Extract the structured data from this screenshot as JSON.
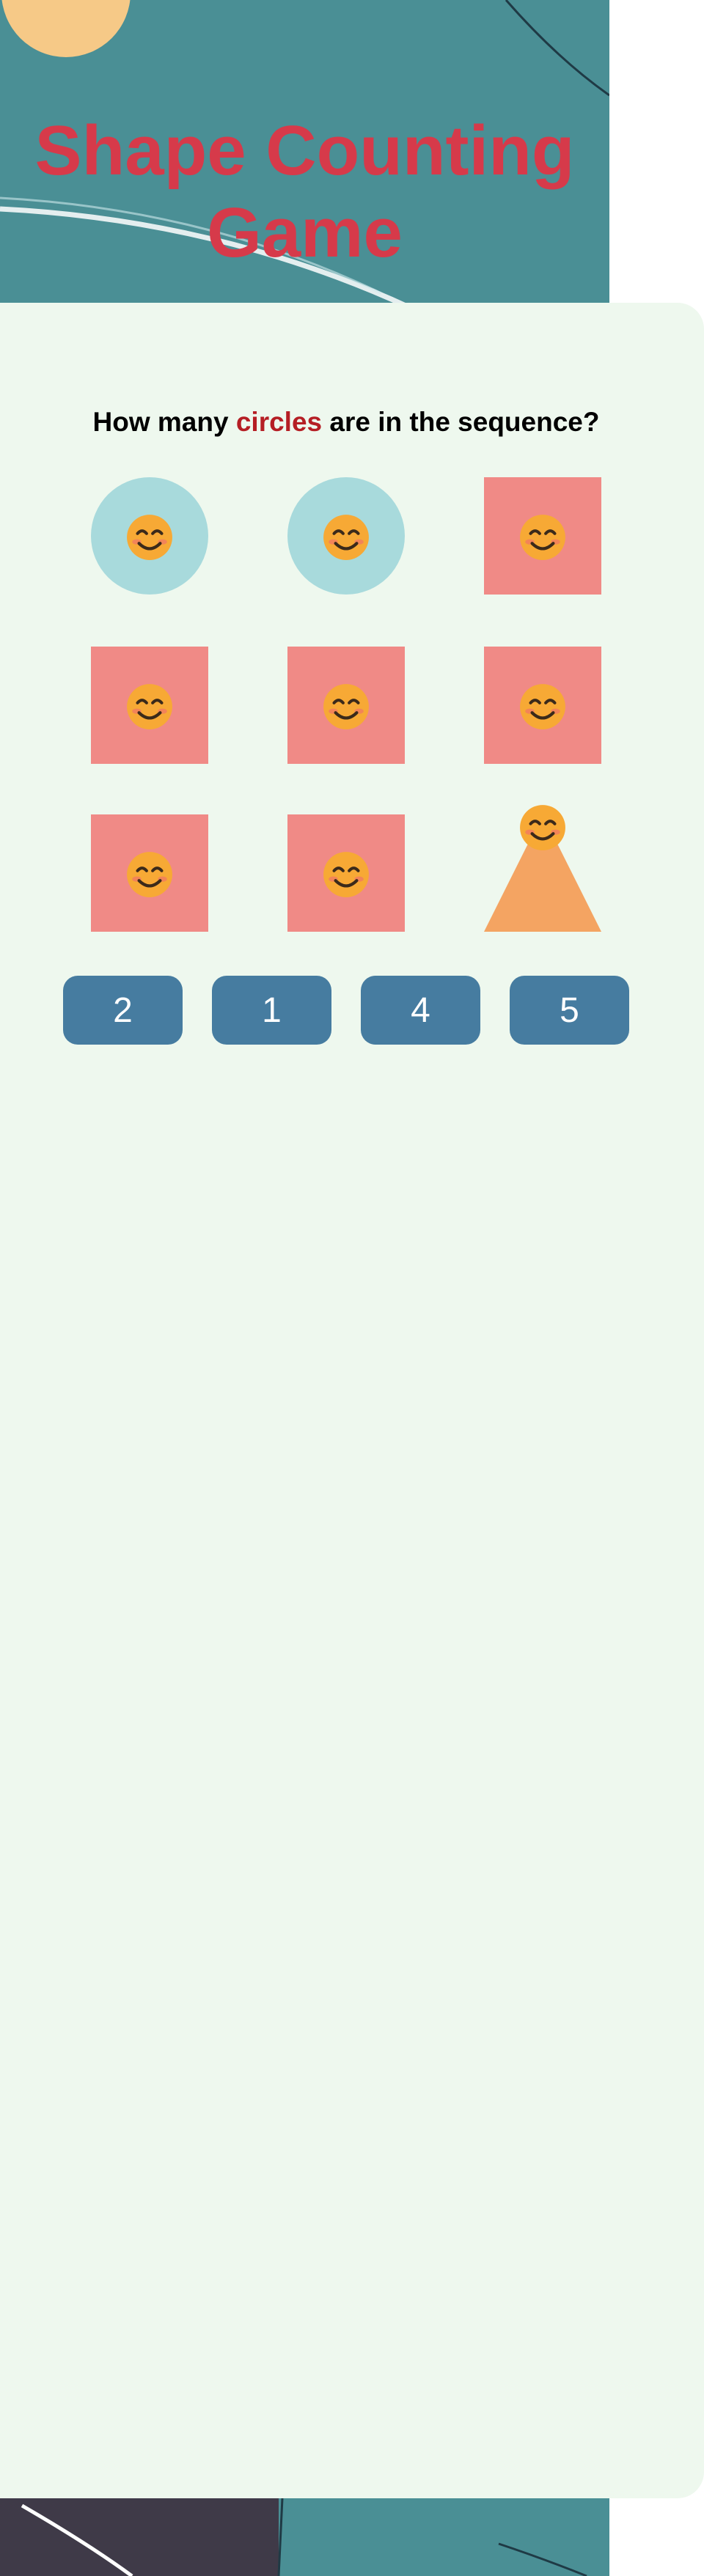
{
  "title": "Shape Counting Game",
  "question": {
    "prefix": "How many",
    "highlight": "circles",
    "suffix": "are in the sequence?"
  },
  "shapes": [
    {
      "type": "circle",
      "icon": "smiling-face-icon"
    },
    {
      "type": "circle",
      "icon": "smiling-face-icon"
    },
    {
      "type": "square",
      "icon": "smiling-face-icon"
    },
    {
      "type": "square",
      "icon": "smiling-face-icon"
    },
    {
      "type": "square",
      "icon": "smiling-face-icon"
    },
    {
      "type": "square",
      "icon": "smiling-face-icon"
    },
    {
      "type": "square",
      "icon": "smiling-face-icon"
    },
    {
      "type": "square",
      "icon": "smiling-face-icon"
    },
    {
      "type": "triangle",
      "icon": "smiling-face-icon"
    }
  ],
  "answers": [
    "2",
    "1",
    "4",
    "5"
  ],
  "colors": {
    "title": "#d63a4a",
    "highlight": "#b51e24",
    "circle": "#a8dadc",
    "square": "#f08a86",
    "triangle": "#f4a462",
    "button": "#467ca0",
    "panel": "#eef8ee",
    "background": "#4a8f95"
  }
}
